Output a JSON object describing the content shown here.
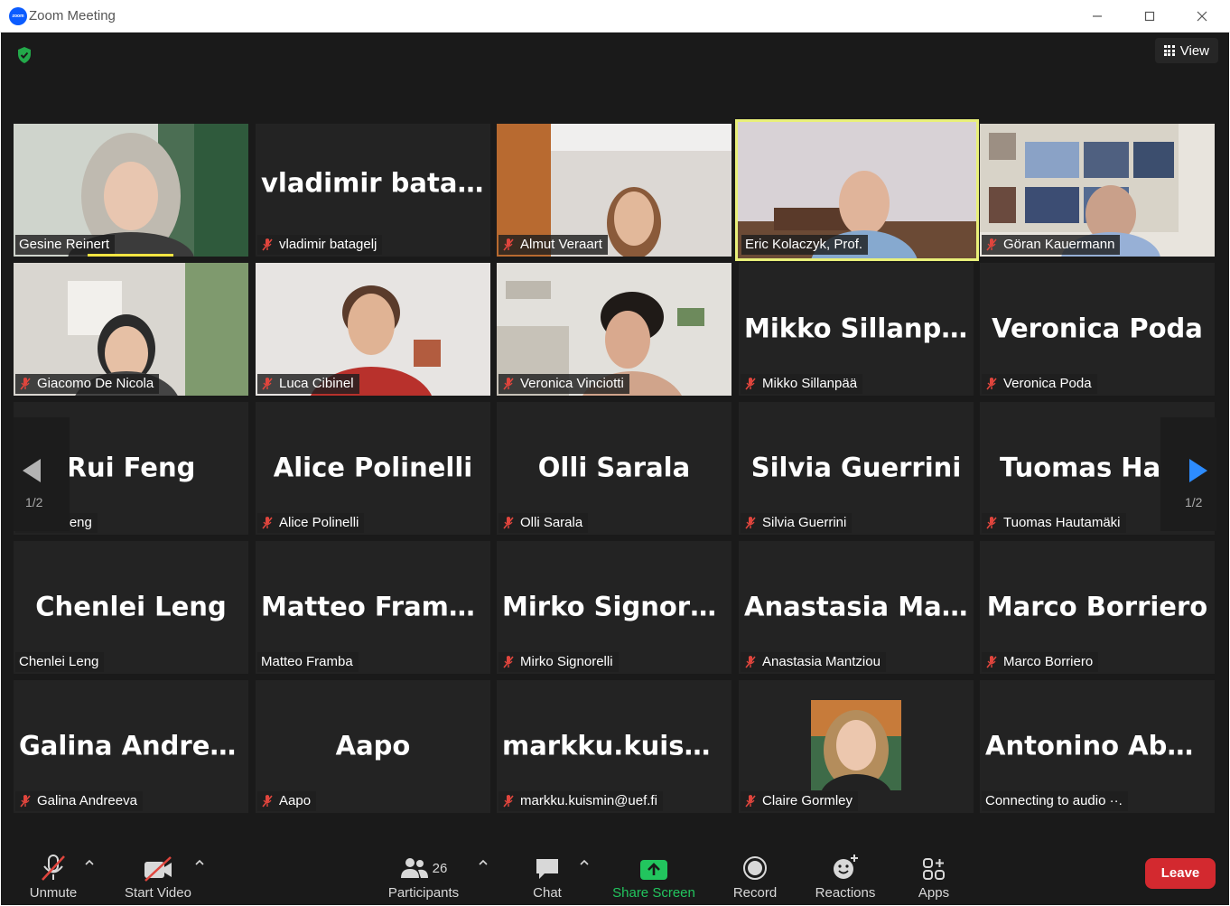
{
  "window": {
    "title": "Zoom Meeting",
    "app_icon_text": "zoom"
  },
  "header": {
    "view_label": "View"
  },
  "tiles": [
    {
      "name": "Gesine Reinert",
      "muted": false,
      "video": true,
      "speaking": true
    },
    {
      "name": "vladimir batagelj",
      "label": "vladimir batagelj",
      "muted": true,
      "video": false
    },
    {
      "name": "Almut Veraart",
      "muted": true,
      "video": true
    },
    {
      "name": "Eric Kolaczyk, Prof.",
      "muted": false,
      "video": true,
      "active": true
    },
    {
      "name": "Göran Kauermann",
      "muted": true,
      "video": true
    },
    {
      "name": "Giacomo De Nicola",
      "muted": true,
      "video": true
    },
    {
      "name": "Luca Cibinel",
      "muted": true,
      "video": true
    },
    {
      "name": "Veronica Vinciotti",
      "muted": true,
      "video": true
    },
    {
      "big": "Mikko Sillanpää",
      "name": "Mikko Sillanpää",
      "muted": true,
      "video": false
    },
    {
      "big": "Veronica Poda",
      "name": "Veronica Poda",
      "muted": true,
      "video": false
    },
    {
      "big": "Rui Feng",
      "name": "Rui Feng",
      "muted": true,
      "video": false
    },
    {
      "big": "Alice Polinelli",
      "name": "Alice Polinelli",
      "muted": true,
      "video": false
    },
    {
      "big": "Olli Sarala",
      "name": "Olli Sarala",
      "muted": true,
      "video": false
    },
    {
      "big": "Silvia Guerrini",
      "name": "Silvia Guerrini",
      "muted": true,
      "video": false
    },
    {
      "big": "Tuomas  Haut",
      "name": "Tuomas Hautamäki",
      "muted": true,
      "video": false
    },
    {
      "big": "Chenlei Leng",
      "name": "Chenlei Leng",
      "muted": false,
      "video": false
    },
    {
      "big": "Matteo Framba",
      "name": "Matteo Framba",
      "muted": false,
      "video": false
    },
    {
      "big": "Mirko Signorelli",
      "name": "Mirko Signorelli",
      "muted": true,
      "video": false
    },
    {
      "big": "Anastasia  Mant...",
      "name": "Anastasia Mantziou",
      "muted": true,
      "video": false
    },
    {
      "big": "Marco Borriero",
      "name": "Marco Borriero",
      "muted": true,
      "video": false
    },
    {
      "big": "Galina Andreeva",
      "name": "Galina Andreeva",
      "muted": true,
      "video": false
    },
    {
      "big": "Aapo",
      "name": "Aapo",
      "muted": true,
      "video": false
    },
    {
      "big": "markku.kuismin...",
      "name": "markku.kuismin@uef.fi",
      "muted": true,
      "video": false
    },
    {
      "name": "Claire Gormley",
      "muted": true,
      "video": false,
      "avatar": true
    },
    {
      "big": "Antonino  Abbr...",
      "name": "Connecting to audio ··.",
      "muted": false,
      "video": false
    }
  ],
  "pager": {
    "left_page": "1/2",
    "right_page": "1/2"
  },
  "toolbar": {
    "unmute": "Unmute",
    "start_video": "Start Video",
    "participants": "Participants",
    "participants_count": "26",
    "chat": "Chat",
    "share_screen": "Share Screen",
    "record": "Record",
    "reactions": "Reactions",
    "apps": "Apps",
    "leave": "Leave"
  },
  "colors": {
    "background": "#1a1a1a",
    "tile": "#232323",
    "active_border": "#e9f07a",
    "share_green": "#22c55e",
    "leave_red": "#d3292f",
    "muted_red": "#e0453d",
    "nav_blue": "#2d8cff"
  }
}
